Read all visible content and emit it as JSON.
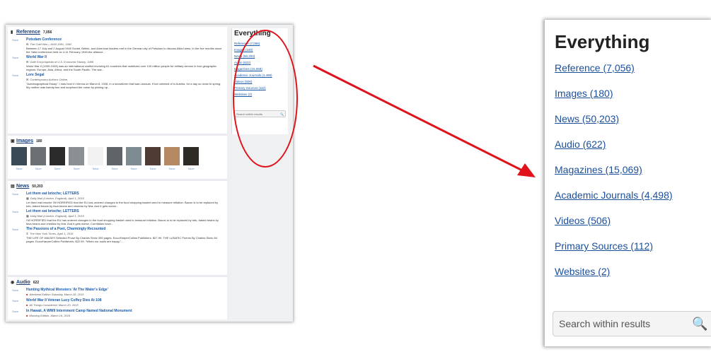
{
  "reference": {
    "label": "Reference",
    "count": "7,056",
    "results": [
      {
        "save": "Save",
        "title": "Potsdam Conference",
        "source": "The Cold War—1945-1991, 1992",
        "snippet": "Between 17 July and 2 August 1945 Soviet, British, and American leaders met in the German city of Potsdam to discuss Allied aims. In the five months since the Yalta conference-held on 4-11 February 1945-the alliance..."
      },
      {
        "save": "Save",
        "title": "World War II",
        "source": "Gale Encyclopedia of U.S. Economic History, 1999",
        "snippet": "World War II (1939-1945) was an international conflict involving 61 countries that mobilized over 100 million people for military service in four geographic regions: Europe, Asia, Africa, and the South Pacific. The war..."
      },
      {
        "save": "Save",
        "title": "Lore Segal",
        "source": "Contemporary Authors Online,",
        "snippet": "\"Autobiographical Essay\": I was born in Vienna on March 8, 1928, in a snowstorm that was unusual, if not unheard of in Austria, for a day so close to spring. My mother was twenty-two and surprised the nurse by picking up..."
      }
    ]
  },
  "images": {
    "label": "Images",
    "count": "180",
    "save_label": "Save",
    "thumb_colors": [
      "#3b4a57",
      "#6a6f74",
      "#2b2b2b",
      "#8a8f93",
      "#f2f2f2",
      "#5e6468",
      "#7d8a8f",
      "#4f3b34",
      "#b58a62",
      "#2e2a26"
    ]
  },
  "news": {
    "label": "News",
    "count": "50,203",
    "results": [
      {
        "save": "Save",
        "title": "Let them eat brioche; LETTERS",
        "source": "Daily Mail (London, England), April 1, 2015",
        "snippet": "Let them eat brioche I'M HORRIFIED that the EU has ordered changes to the food shopping basket used to measure inflation. Bacon is to be replaced by tofu, baked beans by fava beans and cheddar by feta. And it gets worse..."
      },
      {
        "save": "Save",
        "title": "Let them eat brioche; LETTERS",
        "source": "Daily Mail (London, England), April 1, 2015",
        "snippet": "I'M HORRIFIED that the EU has ordered changes to the food shopping basket used to measure inflation. Bacon is to be replaced by tofu, baked beans by fava beans and cheddar by feta. And it gets worse. Cornflakes have..."
      },
      {
        "save": "Save",
        "title": "The Passions of a Poet, Charmingly Recounted",
        "source": "The New York Times, April 1, 2015",
        "snippet": "THE LIFE OF IMAGES Selected Prose By Charles Simic 339 pages. Ecco/HarperCollins Publishers. $27.99. THE LUNATIC Poems By Charles Simic 84 pages. Ecco/HarperCollins Publishers. $22.99. \"When our souls are happy,\"..."
      }
    ]
  },
  "audio": {
    "label": "Audio",
    "count": "622",
    "results": [
      {
        "save": "Save",
        "title": "Hunting Mythical Monsters 'At The Water's Edge'",
        "source": "Weekend Edition Saturday, March 28, 2015"
      },
      {
        "save": "Save",
        "title": "World War II Veteran Lucy Coffey Dies At 108",
        "source": "All Things Considered, March 20, 2015"
      },
      {
        "save": "Save",
        "title": "In Hawaii, A WWII Internment Camp Named National Monument",
        "source": "Morning Edition, March 16, 2015"
      }
    ]
  },
  "facets": {
    "title": "Everything",
    "items": [
      "Reference (7,056)",
      "Images (180)",
      "News (50,203)",
      "Audio (622)",
      "Magazines (15,069)",
      "Academic Journals (4,498)",
      "Videos (506)",
      "Primary Sources (112)",
      "Websites (2)"
    ],
    "search_placeholder": "Search within results"
  },
  "colors": {
    "highlight": "#e0131a",
    "link": "#1a4f9c"
  }
}
